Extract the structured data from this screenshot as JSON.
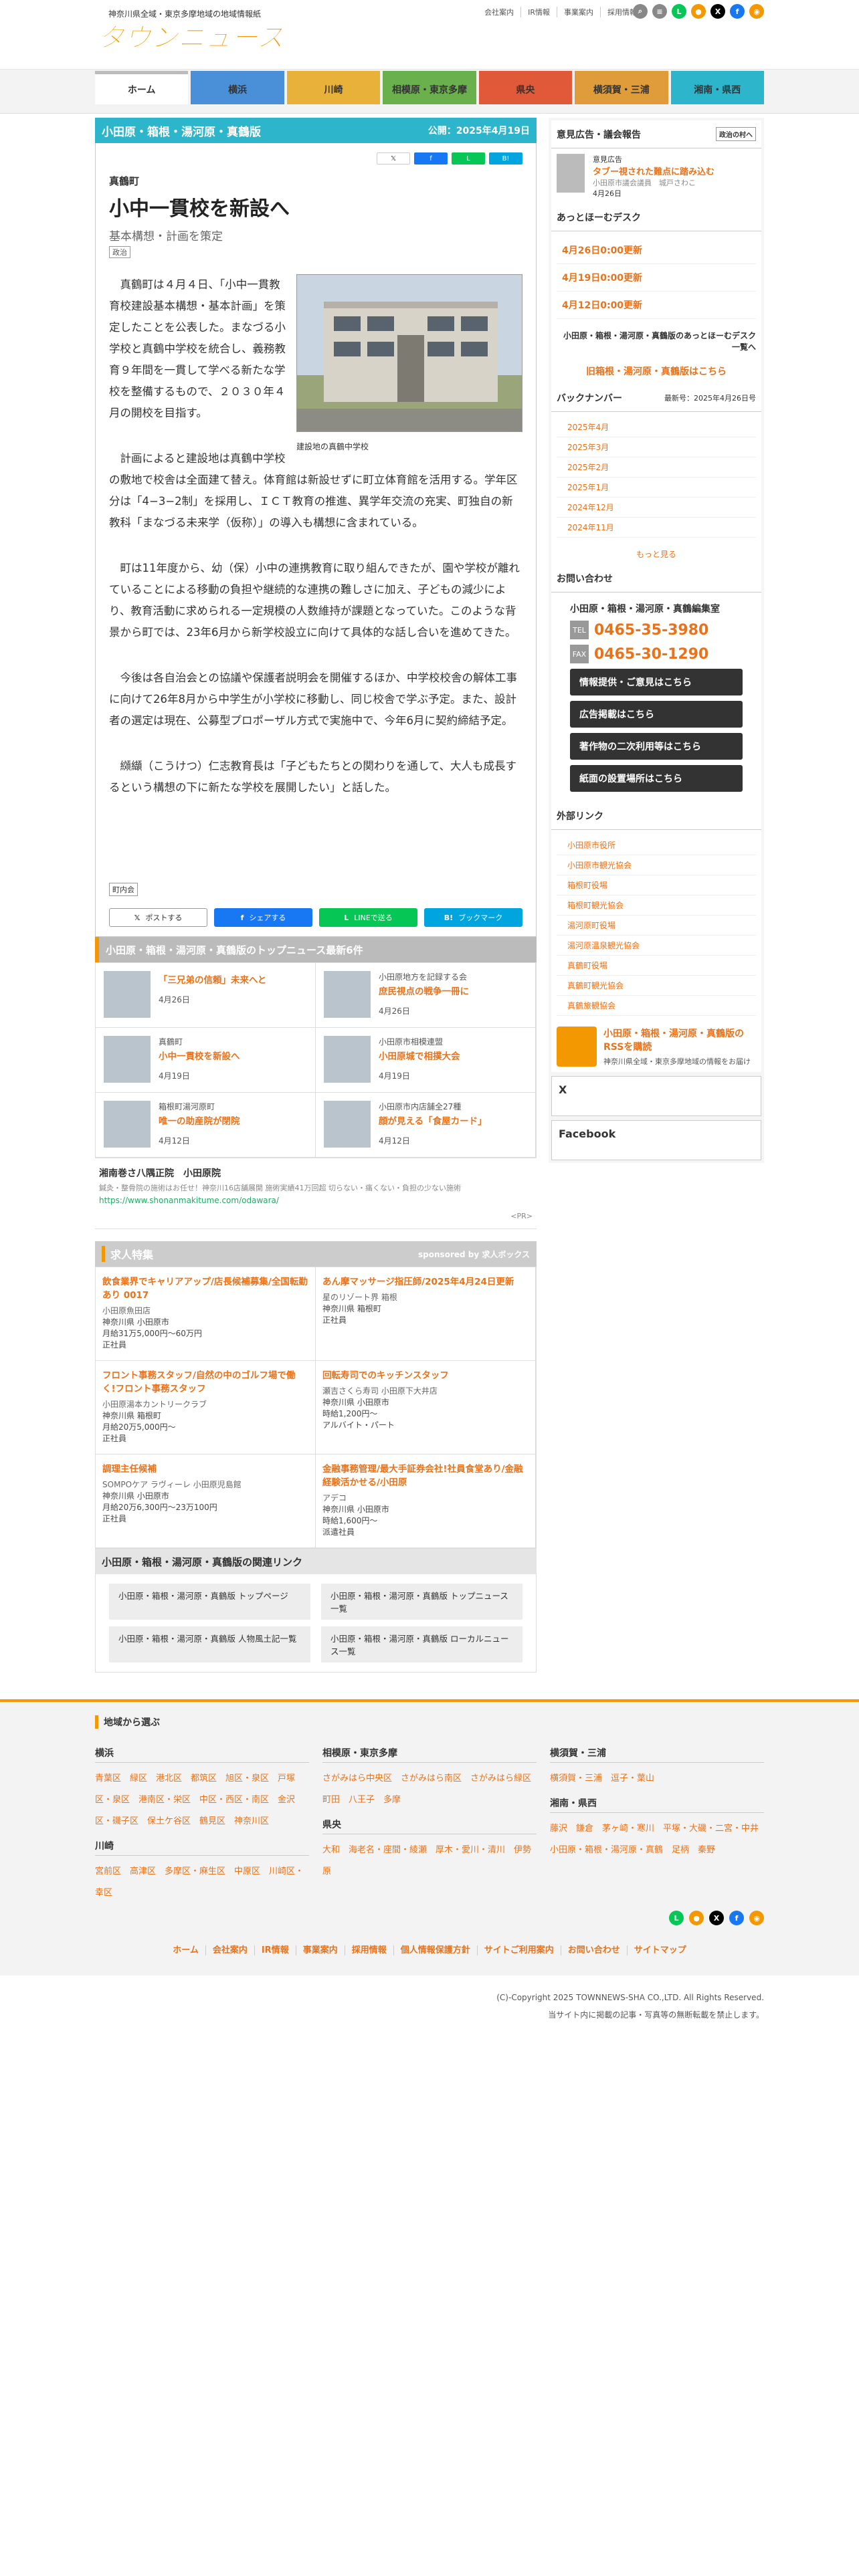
{
  "header": {
    "tagline": "神奈川県全域・東京多摩地域の地域情報紙",
    "logo_text": "タウンニュース",
    "links": [
      "会社案内",
      "IR情報",
      "事業案内",
      "採用情報"
    ]
  },
  "nav": [
    {
      "label": "ホーム",
      "color": "#bbbbbb"
    },
    {
      "label": "横浜",
      "color": "#4a90d9"
    },
    {
      "label": "川崎",
      "color": "#e8b23a"
    },
    {
      "label": "相模原・東京多摩",
      "color": "#6ab04c"
    },
    {
      "label": "県央",
      "color": "#e05a3a"
    },
    {
      "label": "横須賀・三浦",
      "color": "#e09c3a"
    },
    {
      "label": "湘南・県西",
      "color": "#2db5cc"
    }
  ],
  "article": {
    "region": "小田原・箱根・湯河原・真鶴版",
    "published": "公開：2025年4月19日",
    "area": "真鶴町",
    "title": "小中一貫校を新設へ",
    "subtitle": "基本構想・計画を策定",
    "tag": "政治",
    "photo_caption": "建設地の真鶴中学校",
    "paragraphs": [
      "真鶴町は４月４日、「小中一貫教育校建設基本構想・基本計画」を策定したことを公表した。まなづる小学校と真鶴中学校を統合し、義務教育９年間を一貫して学べる新たな学校を整備するもので、２０３０年４月の開校を目指す。",
      "計画によると建設地は真鶴中学校の敷地で校舎は全面建て替え。体育館は新設せずに町立体育館を活用する。学年区分は「4−3−2制」を採用し、ＩＣＴ教育の推進、異学年交流の充実、町独自の新教科「まなづる未来学（仮称）」の導入も構想に含まれている。",
      "町は11年度から、幼（保）小中の連携教育に取り組んできたが、園や学校が離れていることによる移動の負担や継続的な連携の難しさに加え、子どもの減少により、教育活動に求められる一定規模の人数維持が課題となっていた。このような背景から町では、23年6月から新学校設立に向けて具体的な話し合いを進めてきた。",
      "今後は各自治会との協議や保護者説明会を開催するほか、中学校校舎の解体工事に向けて26年8月から中学生が小学校に移動し、同じ校舎で学ぶ予定。また、設計者の選定は現在、公募型プロポーザル方式で実施中で、今年6月に契約締結予定。",
      "纐纈（こうけつ）仁志教育長は「子どもたちとの関わりを通して、大人も成長するという構想の下に新たな学校を展開したい」と話した。"
    ],
    "author_tag": "町内会",
    "share": [
      "ポストする",
      "シェアする",
      "LINEで送る",
      "ブックマーク"
    ]
  },
  "topnews": {
    "heading": "小田原・箱根・湯河原・真鶴版のトップニュース最新6件",
    "items": [
      {
        "area": "",
        "title": "「三兄弟の信頼」未来へと",
        "date": "4月26日"
      },
      {
        "area": "小田原地方を記録する会",
        "title": "庶民視点の戦争一冊に",
        "date": "4月26日"
      },
      {
        "area": "真鶴町",
        "title": "小中一貫校を新設へ",
        "date": "4月19日"
      },
      {
        "area": "小田原市相模連盟",
        "title": "小田原城で相撲大会",
        "date": "4月19日"
      },
      {
        "area": "箱根町湯河原町",
        "title": "唯一の助産院が閉院",
        "date": "4月12日"
      },
      {
        "area": "小田原市内店舗全27種",
        "title": "顔が見える「食屋カード」",
        "date": "4月12日"
      }
    ]
  },
  "pr": {
    "name": "湘南巻さ八隅正院　小田原院",
    "desc": "鍼灸・整骨院の施術はお任せ！神奈川16店舗展開 施術実績41万回超 切らない・痛くない・負担の少ない施術",
    "url": "https://www.shonanmakitume.com/odawara/",
    "tag": "<PR>"
  },
  "jobs": {
    "heading": "求人特集",
    "sponsor": "sponsored by 求人ボックス",
    "items": [
      {
        "title": "飲食業界でキャリアアップ/店長候補募集/全国転勤あり 0017",
        "company": "小田原魚田店",
        "loc": "神奈川県 小田原市",
        "pay": "月給31万5,000円〜60万円",
        "type": "正社員"
      },
      {
        "title": "あん摩マッサージ指圧師/2025年4月24日更新",
        "company": "星のリゾート界 箱根",
        "loc": "神奈川県 箱根町",
        "pay": "",
        "type": "正社員"
      },
      {
        "title": "フロント事務スタッフ/自然の中のゴルフ場で働く!フロント事務スタッフ",
        "company": "小田原湯本カントリークラブ",
        "loc": "神奈川県 箱根町",
        "pay": "月給20万5,000円〜",
        "type": "正社員"
      },
      {
        "title": "回転寿司でのキッチンスタッフ",
        "company": "瀬吉さくら寿司 小田原下大井店",
        "loc": "神奈川県 小田原市",
        "pay": "時給1,200円〜",
        "type": "アルバイト・パート"
      },
      {
        "title": "調理主任候補",
        "company": "SOMPOケア ラヴィーレ 小田原児島館",
        "loc": "神奈川県 小田原市",
        "pay": "月給20万6,300円〜23万100円",
        "type": "正社員"
      },
      {
        "title": "金融事務管理/最大手証券会社!社員食堂あり/金融経験活かせる/小田原",
        "company": "アデコ",
        "loc": "神奈川県 小田原市",
        "pay": "時給1,600円〜",
        "type": "派遣社員"
      }
    ]
  },
  "related": {
    "heading": "小田原・箱根・湯河原・真鶴版の関連リンク",
    "items": [
      "小田原・箱根・湯河原・真鶴版 トップページ",
      "小田原・箱根・湯河原・真鶴版 トップニュース一覧",
      "小田原・箱根・湯河原・真鶴版 人物風土記一覧",
      "小田原・箱根・湯河原・真鶴版 ローカルニュース一覧"
    ]
  },
  "side": {
    "opinion_head": "意見広告・議会報告",
    "opinion_btn": "政治の村へ",
    "ad_label": "意見広告",
    "ad_title": "タブー視された難点に踏み込む",
    "ad_author": "小田原市議会議員　城戸さわこ",
    "ad_date": "4月26日",
    "desk_head": "あっとほーむデスク",
    "desk": [
      "4月26日0:00更新",
      "4月19日0:00更新",
      "4月12日0:00更新"
    ],
    "desk_link": "小田原・箱根・湯河原・真鶴版のあっとほーむデスク一覧へ",
    "old_link": "旧箱根・湯河原・真鶴版はこちら",
    "bn_head": "バックナンバー",
    "bn_latest": "最新号：2025年4月26日号",
    "bn": [
      "2025年4月",
      "2025年3月",
      "2025年2月",
      "2025年1月",
      "2024年12月",
      "2024年11月"
    ],
    "bn_more": "もっと見る",
    "contact_head": "お問い合わせ",
    "contact_office": "小田原・箱根・湯河原・真鶴編集室",
    "tel_label": "TEL",
    "tel": "0465-35-3980",
    "fax_label": "FAX",
    "fax": "0465-30-1290",
    "buttons": [
      "情報提供・ご意見はこちら",
      "広告掲載はこちら",
      "著作物の二次利用等はこちら",
      "紙面の設置場所はこちら"
    ],
    "ext_head": "外部リンク",
    "ext": [
      "小田原市役所",
      "小田原市観光協会",
      "箱根町役場",
      "箱根町観光協会",
      "湯河原町役場",
      "湯河原温泉観光協会",
      "真鶴町役場",
      "真鶴町観光協会",
      "真鶴旅観協会"
    ],
    "rss_title": "小田原・箱根・湯河原・真鶴版のRSSを購読",
    "rss_sub": "神奈川県全域・東京多摩地域の情報をお届け",
    "x_head": "X",
    "fb_head": "Facebook"
  },
  "footer": {
    "heading": "地域から選ぶ",
    "cols": [
      {
        "groups": [
          {
            "h": "横浜",
            "items": "青葉区　緑区　港北区　都筑区　旭区・泉区　戸塚区・泉区　港南区・栄区　中区・西区・南区　金沢区・磯子区　保土ケ谷区　鶴見区　神奈川区"
          },
          {
            "h": "川崎",
            "items": "宮前区　高津区　多摩区・麻生区　中原区　川崎区・幸区"
          }
        ]
      },
      {
        "groups": [
          {
            "h": "相模原・東京多摩",
            "items": "さがみはら中央区　さがみはら南区　さがみはら緑区　町田　八王子　多摩"
          },
          {
            "h": "県央",
            "items": "大和　海老名・座間・綾瀬　厚木・愛川・清川　伊勢原"
          }
        ]
      },
      {
        "groups": [
          {
            "h": "横須賀・三浦",
            "items": "横須賀・三浦　逗子・葉山"
          },
          {
            "h": "湘南・県西",
            "items": "藤沢　鎌倉　茅ヶ崎・寒川　平塚・大磯・二宮・中井　小田原・箱根・湯河原・真鶴　足柄　秦野"
          }
        ]
      }
    ],
    "links": [
      "ホーム",
      "会社案内",
      "IR情報",
      "事業案内",
      "採用情報",
      "個人情報保護方針",
      "サイトご利用案内",
      "お問い合わせ",
      "サイトマップ"
    ],
    "copyright": "(C)-Copyright 2025 TOWNNEWS-SHA CO.,LTD. All Rights Reserved.",
    "notice": "当サイト内に掲載の記事・写真等の無断転載を禁止します。"
  }
}
